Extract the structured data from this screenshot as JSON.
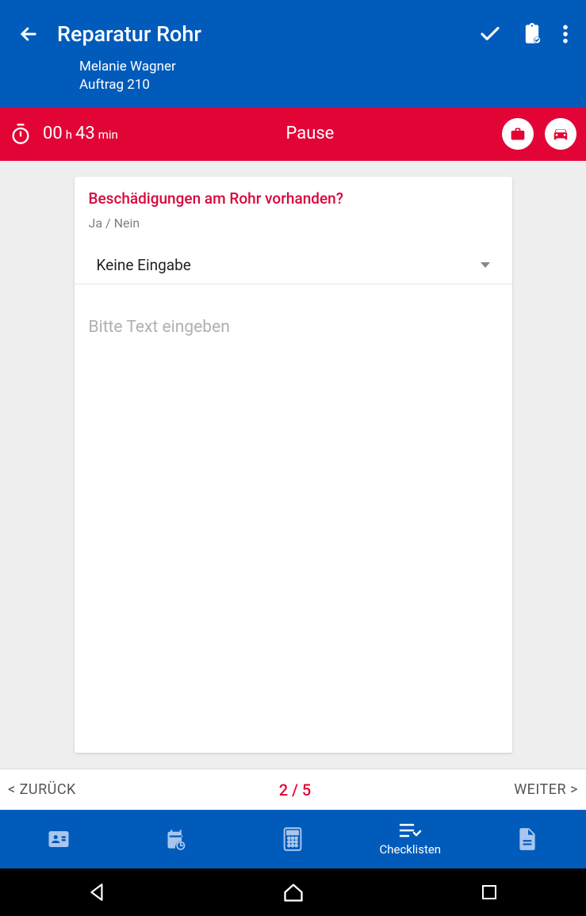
{
  "header": {
    "title": "Reparatur Rohr",
    "customer_name": "Melanie Wagner",
    "order_label": "Auftrag 210"
  },
  "timer": {
    "hours_value": "00",
    "hours_unit": "h",
    "minutes_value": "43",
    "minutes_unit": "min",
    "center_label": "Pause"
  },
  "question": {
    "title": "Beschädigungen am Rohr vorhanden?",
    "type_hint": "Ja / Nein",
    "select_value": "Keine Eingabe",
    "text_placeholder": "Bitte Text eingeben"
  },
  "pager": {
    "back_label": "< ZURÜCK",
    "indicator": "2 / 5",
    "next_label": "WEITER >"
  },
  "tabs": {
    "active_label": "Checklisten"
  },
  "colors": {
    "primary": "#005bbb",
    "accent": "#e30436"
  }
}
